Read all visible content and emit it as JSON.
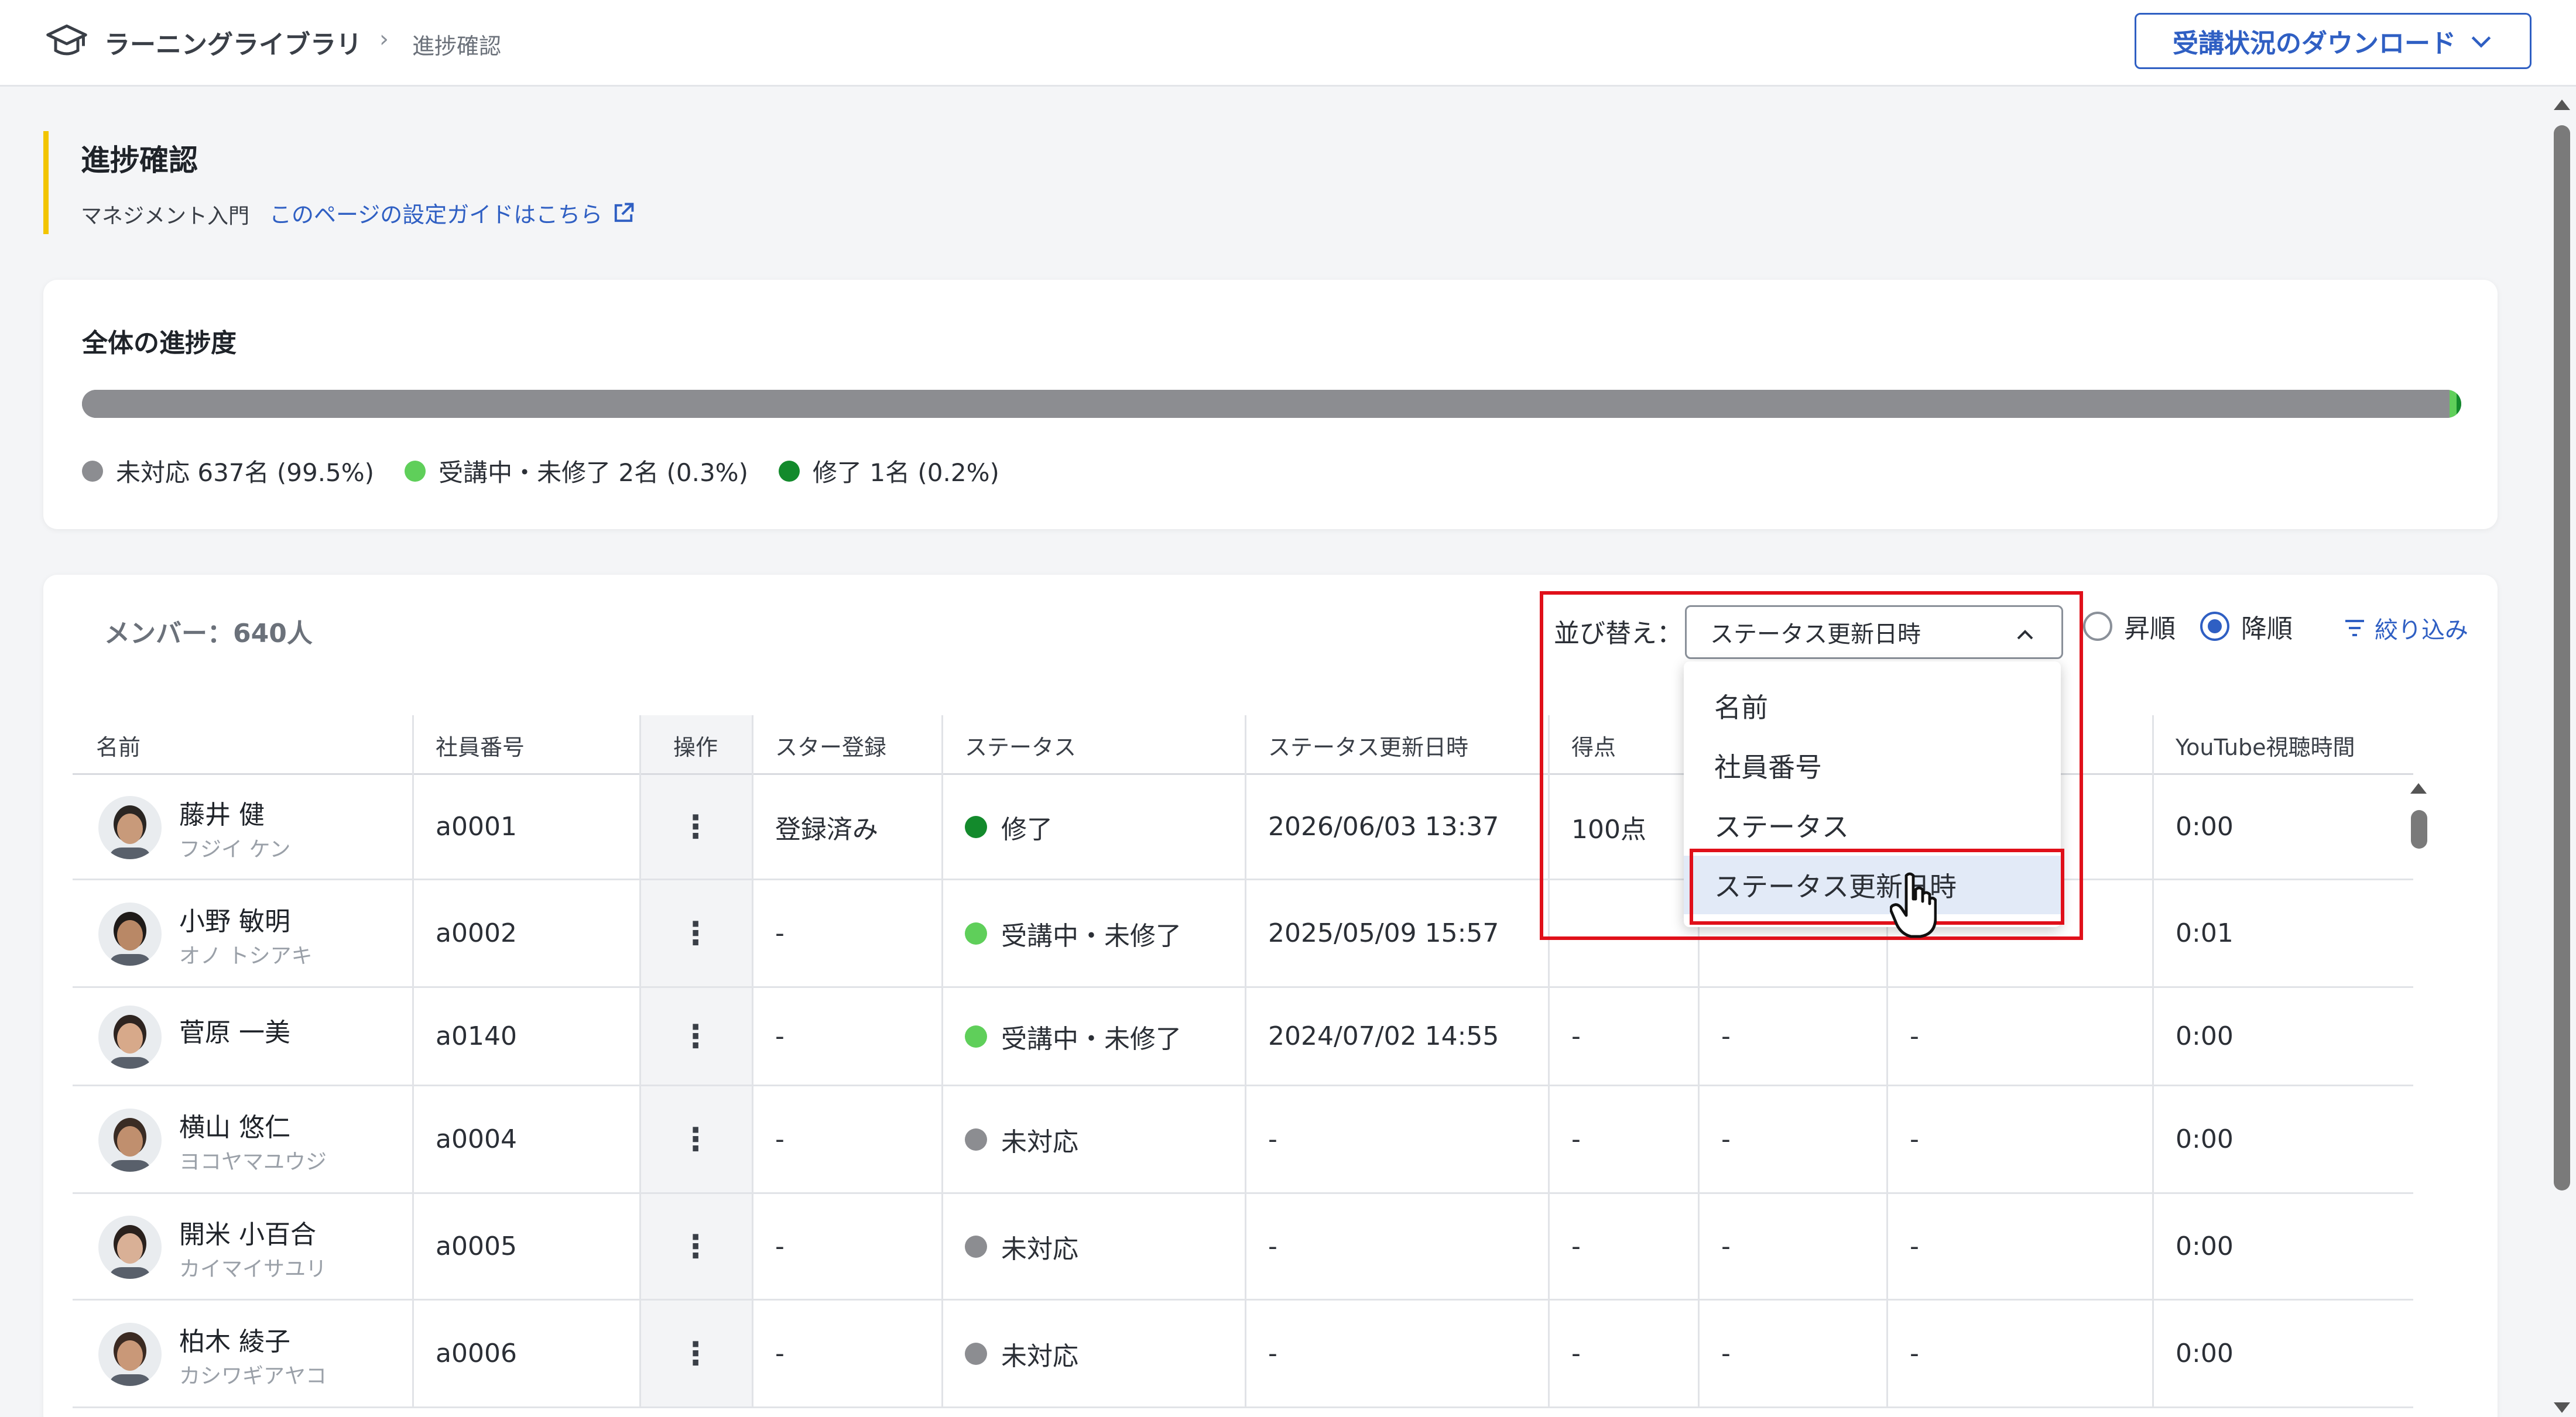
{
  "header": {
    "app_title": "ラーニングライブラリ",
    "breadcrumb_separator": "›",
    "breadcrumb_current": "進捗確認",
    "download_label": "受講状況のダウンロード"
  },
  "page": {
    "title": "進捗確認",
    "course": "マネジメント入門",
    "guide_link": "このページの設定ガイドはこちら"
  },
  "progress": {
    "title": "全体の進捗度",
    "segments": [
      {
        "label": "未対応 637名 (99.5%)",
        "fraction": 0.995,
        "color": "#8c8d91"
      },
      {
        "label": "受講中・未修了 2名 (0.3%)",
        "fraction": 0.003,
        "color": "#5fcf5a"
      },
      {
        "label": "修了 1名 (0.2%)",
        "fraction": 0.002,
        "color": "#138a2c"
      }
    ]
  },
  "members": {
    "count_label": "メンバー：640人",
    "sort_label": "並び替え：",
    "sort_value": "ステータス更新日時",
    "asc_label": "昇順",
    "desc_label": "降順",
    "order": "desc",
    "filter_label": "絞り込み",
    "columns": [
      "名前",
      "社員番号",
      "操作",
      "スター登録",
      "ステータス",
      "ステータス更新日時",
      "得点",
      "",
      "",
      "YouTube視聴時間"
    ],
    "rows": [
      {
        "name": "藤井 健",
        "kana": "フジイ ケン",
        "id": "a0001",
        "star": "登録済み",
        "status": "修了",
        "status_color": "#138a2c",
        "updated": "2026/06/03 13:37",
        "score": "100点",
        "c8": "",
        "c9": "",
        "youtube": "0:00"
      },
      {
        "name": "小野 敏明",
        "kana": "オノ トシアキ",
        "id": "a0002",
        "star": "-",
        "status": "受講中・未修了",
        "status_color": "#5fcf5a",
        "updated": "2025/05/09 15:57",
        "score": "",
        "c8": "",
        "c9": "",
        "youtube": "0:01"
      },
      {
        "name": "菅原 一美",
        "kana": "",
        "id": "a0140",
        "star": "-",
        "status": "受講中・未修了",
        "status_color": "#5fcf5a",
        "updated": "2024/07/02 14:55",
        "score": "-",
        "c8": "-",
        "c9": "-",
        "youtube": "0:00"
      },
      {
        "name": "横山 悠仁",
        "kana": "ヨコヤマユウジ",
        "id": "a0004",
        "star": "-",
        "status": "未対応",
        "status_color": "#8c8d91",
        "updated": "-",
        "score": "-",
        "c8": "-",
        "c9": "-",
        "youtube": "0:00"
      },
      {
        "name": "開米 小百合",
        "kana": "カイマイサユリ",
        "id": "a0005",
        "star": "-",
        "status": "未対応",
        "status_color": "#8c8d91",
        "updated": "-",
        "score": "-",
        "c8": "-",
        "c9": "-",
        "youtube": "0:00"
      },
      {
        "name": "柏木 綾子",
        "kana": "カシワギアヤコ",
        "id": "a0006",
        "star": "-",
        "status": "未対応",
        "status_color": "#8c8d91",
        "updated": "-",
        "score": "-",
        "c8": "-",
        "c9": "-",
        "youtube": "0:00"
      }
    ],
    "kebab": "⋮"
  },
  "sort_dropdown": {
    "options": [
      "名前",
      "社員番号",
      "ステータス",
      "ステータス更新日時"
    ],
    "selected_index": 3
  },
  "icons": {
    "logo": "graduation-cap-icon",
    "download_chevron": "chevron-down-icon",
    "external_link": "external-link-icon",
    "select_chevron": "chevron-up-icon",
    "filter": "filter-icon",
    "row_menu": "kebab-menu-icon",
    "cursor": "hand-pointer-icon"
  },
  "colors": {
    "accent": "#2f5fc3",
    "heading_bar": "#f2c500",
    "highlight": "#e0101a"
  }
}
